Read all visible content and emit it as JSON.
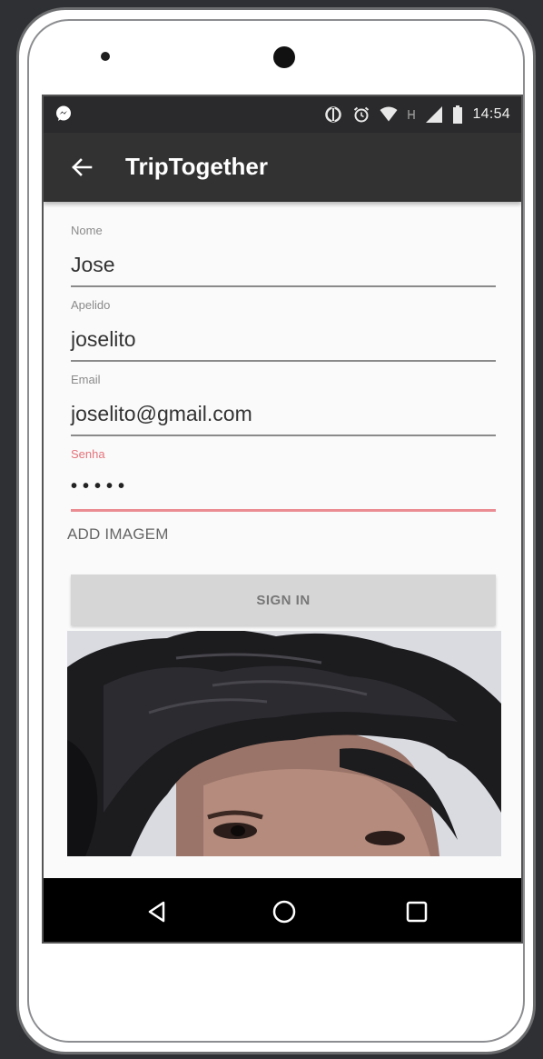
{
  "status_bar": {
    "time": "14:54",
    "icons": [
      "messenger-icon",
      "data-saver-icon",
      "alarm-icon",
      "wifi-icon",
      "signal-icon",
      "battery-icon"
    ]
  },
  "app_bar": {
    "title": "TripTogether",
    "back_icon": "arrow-back-icon"
  },
  "form": {
    "fields": [
      {
        "label": "Nome",
        "value": "Jose"
      },
      {
        "label": "Apelido",
        "value": "joselito"
      },
      {
        "label": "Email",
        "value": "joselito@gmail.com"
      },
      {
        "label": "Senha",
        "value": "•••••"
      }
    ],
    "add_image_label": "ADD IMAGEM",
    "sign_in_label": "SIGN IN"
  },
  "nav_bar": {
    "icons": [
      "back-triangle-icon",
      "home-circle-icon",
      "recents-square-icon"
    ]
  },
  "colors": {
    "app_bar": "#323232",
    "status_bar": "#2a2a2c",
    "error_accent": "#ea8c92",
    "button_bg": "#d6d6d6",
    "frame_bg": "#2f3033"
  }
}
